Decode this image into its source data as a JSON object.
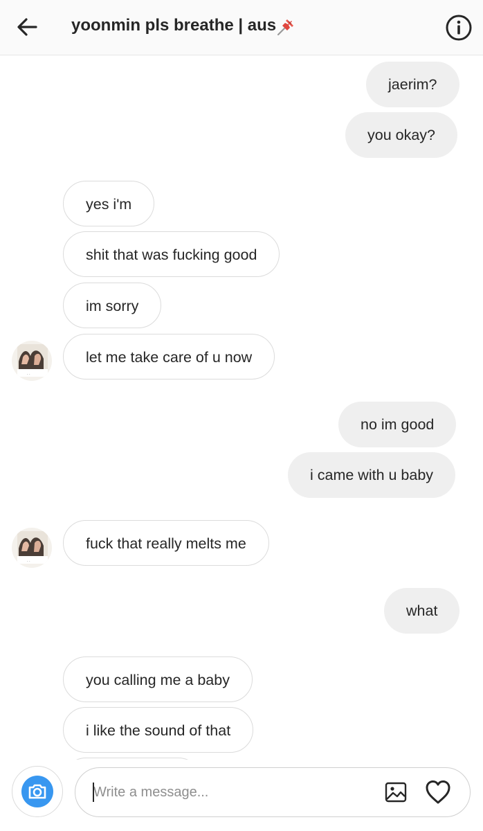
{
  "header": {
    "title": "yoonmin pls breathe | aus",
    "icons": [
      "back-arrow-icon",
      "pushpin-icon",
      "info-icon"
    ]
  },
  "messages": [
    {
      "from": "me",
      "text": "jaerim?"
    },
    {
      "from": "me",
      "text": "you okay?"
    },
    {
      "from": "them",
      "text": "yes i'm"
    },
    {
      "from": "them",
      "text": "shit that was fucking good"
    },
    {
      "from": "them",
      "text": "im sorry"
    },
    {
      "from": "them",
      "text": "let me take care of u now"
    },
    {
      "from": "me",
      "text": "no im good"
    },
    {
      "from": "me",
      "text": "i came with u baby"
    },
    {
      "from": "them",
      "text": "fuck that really melts me"
    },
    {
      "from": "me",
      "text": "what"
    },
    {
      "from": "them",
      "text": "you calling me a baby"
    },
    {
      "from": "them",
      "text": "i like the sound of that"
    }
  ],
  "composer": {
    "placeholder": "Write a message...",
    "icons": [
      "camera-icon",
      "gallery-icon",
      "heart-icon"
    ]
  },
  "colors": {
    "outgoing_bubble": "#efefef",
    "incoming_border": "#dbdbdb",
    "camera_accent": "#3897f0",
    "text": "#262626"
  }
}
